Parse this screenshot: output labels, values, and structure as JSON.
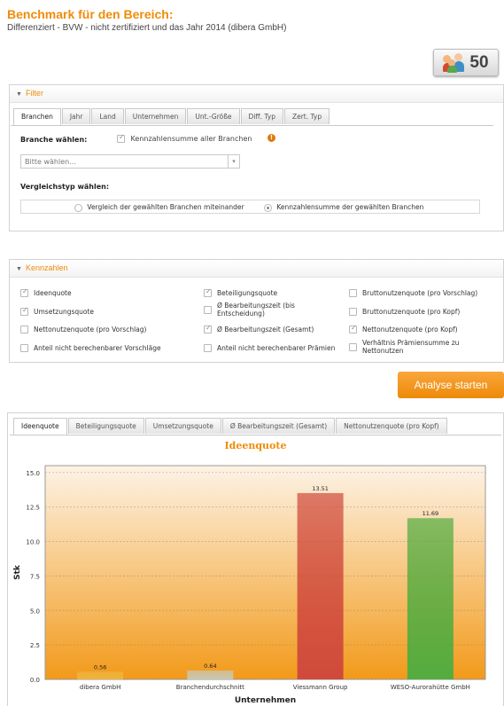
{
  "page": {
    "title": "Benchmark für den Bereich:",
    "subtitle": "Differenziert - BVW - nicht zertifiziert und das Jahr 2014 (dibera GmbH)",
    "count": "50",
    "count_icon": "people-group-icon"
  },
  "filter": {
    "header": "Filter",
    "tabs": [
      "Branchen",
      "Jahr",
      "Land",
      "Unternehmen",
      "Unt.-Größe",
      "Diff. Typ",
      "Zert. Typ"
    ],
    "branche_label": "Branche wählen:",
    "sum_all_label": "Kennzahlensumme aller Branchen",
    "select_placeholder": "Bitte wählen...",
    "vergleich_label": "Vergleichstyp wählen:",
    "radio1": "Vergleich der gewählten Branchen miteinander",
    "radio2": "Kennzahlensumme der gewählten Branchen"
  },
  "kennzahlen": {
    "header": "Kennzahlen",
    "items": [
      {
        "label": "Ideenquote",
        "checked": true
      },
      {
        "label": "Beteiligungsquote",
        "checked": true
      },
      {
        "label": "Bruttonutzenquote (pro Vorschlag)",
        "checked": false
      },
      {
        "label": "Umsetzungsquote",
        "checked": true
      },
      {
        "label": "Ø Bearbeitungszeit (bis Entscheidung)",
        "checked": false
      },
      {
        "label": "Bruttonutzenquote (pro Kopf)",
        "checked": false
      },
      {
        "label": "Nettonutzenquote (pro Vorschlag)",
        "checked": false
      },
      {
        "label": "Ø Bearbeitungszeit (Gesamt)",
        "checked": true
      },
      {
        "label": "Nettonutzenquote (pro Kopf)",
        "checked": true
      },
      {
        "label": "Anteil nicht berechenbarer Vorschläge",
        "checked": false
      },
      {
        "label": "Anteil nicht berechenbarer Prämien",
        "checked": false
      },
      {
        "label": "Verhältnis Prämiensumme zu Nettonutzen",
        "checked": false
      }
    ]
  },
  "start_button": "Analyse starten",
  "chart_tabs": [
    "Ideenquote",
    "Beteiligungsquote",
    "Umsetzungsquote",
    "Ø Bearbeitungszeit (Gesamt)",
    "Nettonutzenquote (pro Kopf)"
  ],
  "chart_data": {
    "type": "bar",
    "title": "Ideenquote",
    "xlabel": "Unternehmen",
    "ylabel": "Stk",
    "categories": [
      "dibera GmbH",
      "Branchendurchschnitt",
      "Viessmann Group",
      "WESO-Aurorahütte GmbH"
    ],
    "values": [
      0.56,
      0.64,
      13.51,
      11.69
    ],
    "value_labels": [
      "0.56",
      "0.64",
      "13.51",
      "11.69"
    ],
    "bar_colors": [
      "#f0b43c",
      "#c8c8b4",
      "#d04a3c",
      "#54ac40"
    ],
    "ylim": [
      0,
      15.5
    ],
    "yticks": [
      "0.0",
      "2.5",
      "5.0",
      "7.5",
      "10.0",
      "12.5",
      "15.0"
    ],
    "grid": true,
    "background_gradient": [
      "#fdf3e6",
      "#f29a1a"
    ]
  }
}
